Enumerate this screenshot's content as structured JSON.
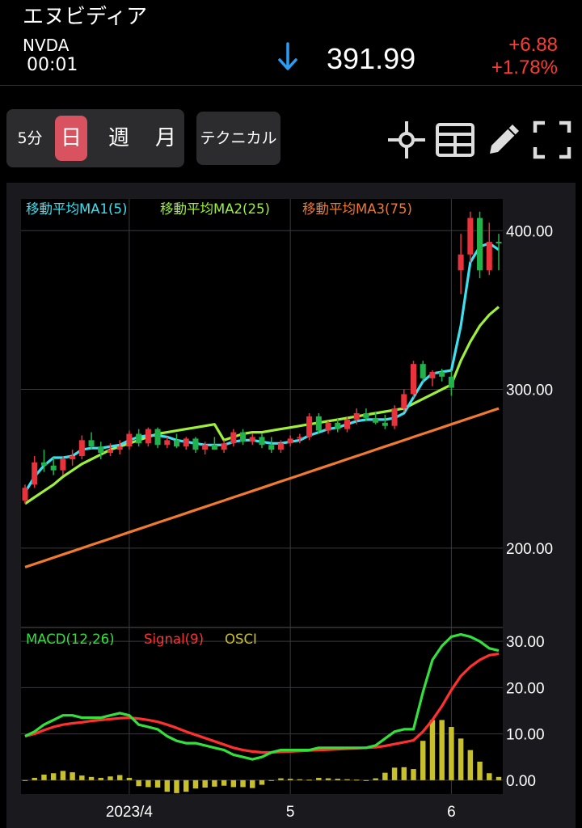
{
  "header": {
    "stock_name": "エヌビディア",
    "ticker": "NVDA",
    "time": "00:01",
    "price": "391.99",
    "change": "+6.88",
    "change_pct": "+1.78%",
    "arrow_icon": "down-arrow-icon",
    "colors": {
      "down_arrow": "#2a9df4",
      "change": "#ff3b30"
    }
  },
  "toolbar": {
    "periods": [
      {
        "label": "5分",
        "active": false
      },
      {
        "label": "日",
        "active": true
      },
      {
        "label": "週",
        "active": false
      },
      {
        "label": "月",
        "active": false
      }
    ],
    "technical_label": "テクニカル",
    "tools": [
      "crosshair-icon",
      "grid-layout-icon",
      "pencil-icon",
      "fullscreen-icon"
    ],
    "colors": {
      "active": "#d9525f",
      "button_bg": "#2c2c2e"
    }
  },
  "chart_data": [
    {
      "type": "candlestick",
      "legend": [
        {
          "name": "移動平均MA1(5)",
          "color": "#3ee0f0"
        },
        {
          "name": "移動平均MA2(25)",
          "color": "#9ef03c"
        },
        {
          "name": "移動平均MA3(75)",
          "color": "#f07a30"
        }
      ],
      "ylim": [
        150,
        420
      ],
      "yticks": [
        {
          "value": 200,
          "label": "200.00"
        },
        {
          "value": 300,
          "label": "300.00"
        },
        {
          "value": 400,
          "label": "400.00"
        }
      ],
      "x_count": 51,
      "candles": [
        [
          230,
          240,
          228,
          238
        ],
        [
          240,
          258,
          238,
          254
        ],
        [
          254,
          262,
          248,
          252
        ],
        [
          252,
          257,
          246,
          249
        ],
        [
          249,
          258,
          246,
          256
        ],
        [
          256,
          262,
          252,
          258
        ],
        [
          258,
          271,
          256,
          268
        ],
        [
          268,
          273,
          262,
          264
        ],
        [
          264,
          267,
          256,
          260
        ],
        [
          260,
          266,
          258,
          262
        ],
        [
          262,
          268,
          259,
          264
        ],
        [
          264,
          274,
          262,
          272
        ],
        [
          272,
          275,
          264,
          266
        ],
        [
          266,
          276,
          264,
          275
        ],
        [
          275,
          276,
          263,
          265
        ],
        [
          265,
          270,
          263,
          268
        ],
        [
          268,
          272,
          263,
          264
        ],
        [
          264,
          270,
          262,
          269
        ],
        [
          269,
          270,
          260,
          262
        ],
        [
          262,
          267,
          259,
          265
        ],
        [
          265,
          270,
          262,
          262
        ],
        [
          262,
          268,
          260,
          266
        ],
        [
          266,
          275,
          264,
          273
        ],
        [
          273,
          275,
          265,
          267
        ],
        [
          267,
          272,
          265,
          270
        ],
        [
          270,
          272,
          263,
          265
        ],
        [
          265,
          270,
          260,
          262
        ],
        [
          262,
          268,
          260,
          266
        ],
        [
          266,
          271,
          264,
          269
        ],
        [
          269,
          272,
          266,
          270
        ],
        [
          270,
          285,
          268,
          283
        ],
        [
          283,
          285,
          272,
          274
        ],
        [
          274,
          280,
          272,
          279
        ],
        [
          279,
          282,
          273,
          275
        ],
        [
          275,
          283,
          273,
          281
        ],
        [
          281,
          288,
          278,
          285
        ],
        [
          285,
          288,
          280,
          282
        ],
        [
          282,
          286,
          278,
          279
        ],
        [
          279,
          284,
          275,
          277
        ],
        [
          277,
          290,
          275,
          288
        ],
        [
          288,
          300,
          286,
          297
        ],
        [
          297,
          318,
          295,
          316
        ],
        [
          316,
          318,
          305,
          307
        ],
        [
          307,
          312,
          302,
          311
        ],
        [
          311,
          313,
          305,
          308
        ],
        [
          308,
          312,
          296,
          301
        ],
        [
          375,
          398,
          360,
          385
        ],
        [
          385,
          412,
          380,
          408
        ],
        [
          408,
          412,
          370,
          375
        ],
        [
          375,
          405,
          372,
          393
        ],
        [
          393,
          398,
          375,
          392
        ]
      ],
      "ma1": [
        235,
        245,
        252,
        257,
        257,
        258,
        262,
        263,
        263,
        264,
        265,
        268,
        270,
        271,
        271,
        270,
        268,
        267,
        266,
        265,
        265,
        265,
        267,
        268,
        268,
        267,
        266,
        266,
        267,
        268,
        271,
        273,
        275,
        276,
        278,
        280,
        281,
        281,
        281,
        282,
        285,
        295,
        305,
        310,
        311,
        312,
        340,
        380,
        390,
        392,
        388
      ],
      "ma2": [
        228,
        232,
        236,
        240,
        245,
        249,
        253,
        256,
        259,
        262,
        264,
        266,
        268,
        270,
        272,
        273,
        274,
        275,
        276,
        277,
        278,
        268,
        270,
        272,
        273,
        273,
        274,
        275,
        276,
        277,
        278,
        279,
        280,
        281,
        282,
        283,
        284,
        285,
        286,
        287,
        288,
        291,
        294,
        297,
        300,
        303,
        318,
        330,
        340,
        347,
        352
      ],
      "ma3": [
        188,
        190,
        192,
        194,
        196,
        198,
        200,
        202,
        204,
        206,
        208,
        210,
        212,
        214,
        216,
        218,
        220,
        222,
        224,
        226,
        228,
        230,
        232,
        234,
        236,
        238,
        240,
        242,
        244,
        246,
        248,
        250,
        252,
        254,
        256,
        258,
        260,
        262,
        264,
        266,
        268,
        270,
        272,
        274,
        276,
        278,
        280,
        282,
        284,
        286,
        288
      ]
    },
    {
      "type": "line",
      "legend": [
        {
          "name": "MACD(12,26)",
          "color": "#33e03c"
        },
        {
          "name": "Signal(9)",
          "color": "#ff3030"
        },
        {
          "name": "OSCI",
          "color": "#c8c02a"
        }
      ],
      "ylim": [
        -3,
        33
      ],
      "yticks": [
        {
          "value": 0,
          "label": "0.00"
        },
        {
          "value": 10,
          "label": "10.00"
        },
        {
          "value": 20,
          "label": "20.00"
        },
        {
          "value": 30,
          "label": "30.00"
        }
      ],
      "x_labels": [
        {
          "index": 11,
          "label": "2023/4"
        },
        {
          "index": 28,
          "label": "5"
        },
        {
          "index": 45,
          "label": "6"
        }
      ],
      "macd": [
        9.5,
        10.5,
        12,
        13,
        14,
        14,
        13.5,
        13.5,
        13.5,
        14,
        14.5,
        14,
        12,
        11.5,
        11,
        9.5,
        8.5,
        8,
        8,
        7.5,
        7,
        6.5,
        5.5,
        5,
        4.5,
        5,
        6,
        6.5,
        6.5,
        6.5,
        6.5,
        7,
        7,
        7,
        7,
        7,
        7,
        7.5,
        9,
        10.5,
        11,
        11,
        19,
        26,
        29,
        31,
        31.5,
        31,
        30,
        28.5,
        28
      ],
      "signal": [
        9.5,
        10,
        10.8,
        11.5,
        12,
        12.3,
        12.5,
        12.8,
        13,
        13.2,
        13.4,
        13.5,
        13.3,
        13,
        12.6,
        12,
        11.3,
        10.5,
        9.8,
        9.1,
        8.4,
        7.7,
        7,
        6.5,
        6.2,
        6,
        6,
        6.1,
        6.2,
        6.3,
        6.4,
        6.5,
        6.6,
        6.7,
        6.8,
        6.9,
        7,
        7.1,
        7.4,
        7.8,
        8.2,
        8.6,
        10.5,
        13,
        16,
        19.5,
        22.5,
        24.5,
        26,
        27,
        27.3
      ],
      "osci": [
        0,
        0.5,
        1.2,
        1.5,
        2,
        1.7,
        1,
        0.7,
        0.5,
        0.8,
        1.1,
        0.5,
        -1.3,
        -1.5,
        -1.6,
        -2.5,
        -2.8,
        -2.5,
        -1.8,
        -1.6,
        -1.4,
        -1.2,
        -1.5,
        -1.5,
        -1.7,
        -1,
        0,
        0.4,
        0.3,
        0.2,
        0.1,
        0.5,
        0.4,
        0.3,
        0.2,
        0.1,
        0,
        0.4,
        1.6,
        2.7,
        2.8,
        2.4,
        8.5,
        13,
        13,
        11.5,
        9,
        6.5,
        4,
        1.5,
        0.7
      ]
    }
  ]
}
